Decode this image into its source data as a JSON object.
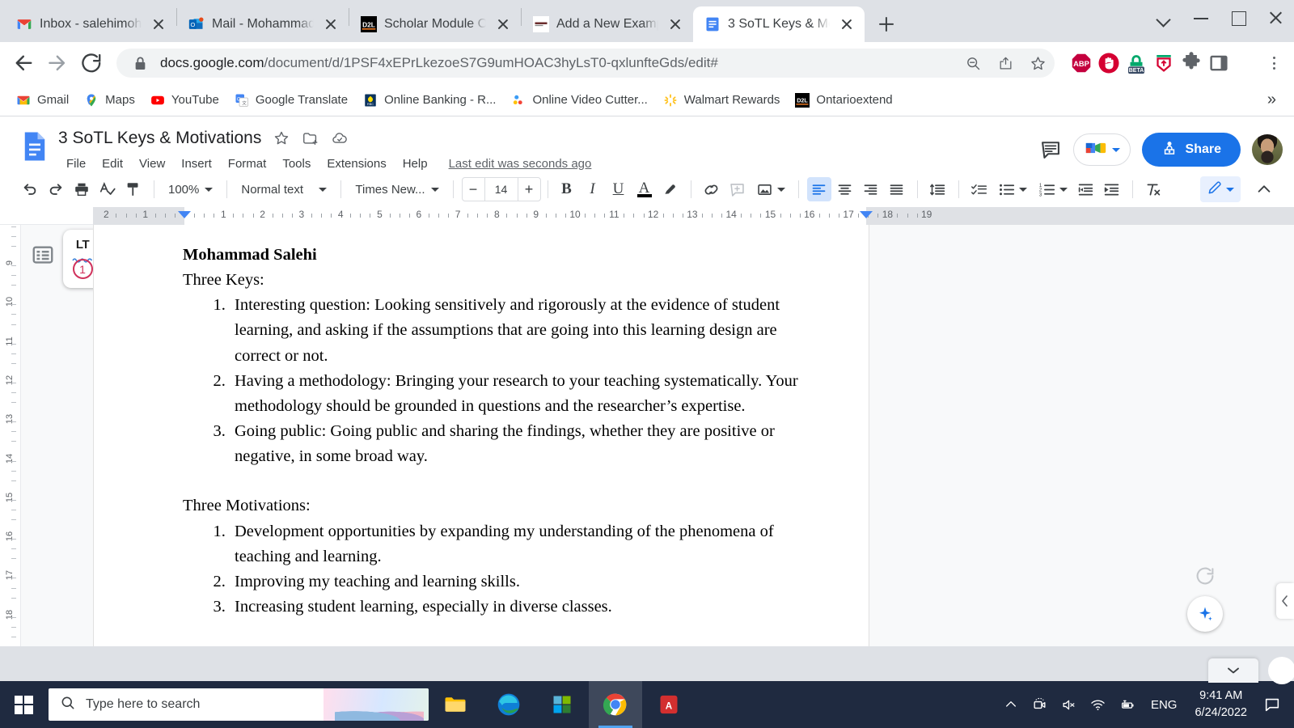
{
  "browser": {
    "tabs": [
      {
        "title": "Inbox - salehimoh",
        "favicon": "gmail-icon",
        "active": false
      },
      {
        "title": "Mail - Mohammad",
        "favicon": "outlook-icon",
        "active": false
      },
      {
        "title": "Scholar Module O",
        "favicon": "d2l-icon",
        "active": false
      },
      {
        "title": "Add a New Examp",
        "favicon": "generic-site-icon",
        "active": false
      },
      {
        "title": "3 SoTL Keys & Mo",
        "favicon": "google-docs-icon",
        "active": true
      }
    ],
    "new_tab_label": "+",
    "window_controls": [
      "chevron-down",
      "minimize",
      "maximize",
      "close"
    ],
    "nav": {
      "back": "back-arrow",
      "forward": "forward-arrow",
      "reload": "reload-icon",
      "lock": "lock-icon"
    },
    "url_host": "docs.google.com",
    "url_path": "/document/d/1PSF4xEPrLkezoeS7G9umHOAC3hyLsT0-qxlunfteGds/edit#",
    "omnibox_icons": [
      "zoom-out-icon",
      "share-icon",
      "bookmark-star-icon"
    ],
    "extensions": [
      "adblock-plus-icon",
      "adblocker-hand-icon",
      "beta-lock-icon",
      "shield-icon",
      "puzzle-icon",
      "side-panel-icon"
    ],
    "profile": "profile-avatar",
    "menu": "chrome-menu-icon",
    "bookmarks": [
      {
        "label": "Gmail",
        "icon": "gmail-icon"
      },
      {
        "label": "Maps",
        "icon": "google-maps-icon"
      },
      {
        "label": "YouTube",
        "icon": "youtube-icon"
      },
      {
        "label": "Google Translate",
        "icon": "google-translate-icon"
      },
      {
        "label": "Online Banking - R...",
        "icon": "rbc-icon"
      },
      {
        "label": "Online Video Cutter...",
        "icon": "video-cutter-icon"
      },
      {
        "label": "Walmart Rewards",
        "icon": "walmart-icon"
      },
      {
        "label": "Ontarioextend",
        "icon": "d2l-icon"
      }
    ],
    "bookmarks_overflow": "»"
  },
  "docs": {
    "title": "3 SoTL Keys & Motivations",
    "title_icons": [
      "star-icon",
      "move-to-folder-icon",
      "cloud-saved-icon"
    ],
    "menu": [
      "File",
      "Edit",
      "View",
      "Insert",
      "Format",
      "Tools",
      "Extensions",
      "Help"
    ],
    "last_edit": "Last edit was seconds ago",
    "comment_icon": "comment-history-icon",
    "meet_icon": "google-meet-icon",
    "share_label": "Share",
    "share_color": "#1a73e8",
    "user_avatar": "user-avatar",
    "toolbar": {
      "undo": "undo-icon",
      "redo": "redo-icon",
      "print": "print-icon",
      "spellcheck": "spellcheck-icon",
      "paint_format": "paint-format-icon",
      "zoom": "100%",
      "style": "Normal text",
      "font": "Times New...",
      "font_size": "14",
      "decrease": "−",
      "increase": "+",
      "bold": "B",
      "italic": "I",
      "underline": "U",
      "text_color": "A",
      "highlight": "highlight-icon",
      "link": "link-icon",
      "comment": "add-comment-icon",
      "image": "insert-image-icon",
      "align_left": "align-left-icon",
      "align_center": "align-center-icon",
      "align_right": "align-right-icon",
      "align_justify": "align-justify-icon",
      "line_spacing": "line-spacing-icon",
      "checklist": "checklist-icon",
      "bulleted_list": "bulleted-list-icon",
      "numbered_list": "numbered-list-icon",
      "decrease_indent": "decrease-indent-icon",
      "increase_indent": "increase-indent-icon",
      "clear_formatting": "clear-formatting-icon",
      "editing_mode": "pencil-icon",
      "collapse": "collapse-toolbar-icon"
    },
    "ruler": {
      "left_numbers": [
        "2",
        "1"
      ],
      "numbers": [
        "1",
        "2",
        "3",
        "4",
        "5",
        "6",
        "7",
        "8",
        "9",
        "10",
        "11",
        "12",
        "13",
        "14",
        "15",
        "16",
        "17",
        "18",
        "19"
      ],
      "left_indent_marker": "indent-marker",
      "right_indent_marker": "right-indent-marker"
    },
    "sidebar": {
      "outline_icon": "document-outline-icon",
      "languagetool": {
        "logo": "LT",
        "count": "1"
      }
    },
    "document": {
      "author": "Mohammad Salehi",
      "section1_heading": "Three Keys:",
      "section1_items": [
        "Interesting question: Looking sensitively and rigorously at the evidence of student learning, and asking if the assumptions that are going into this learning design are correct or not.",
        "Having a methodology: Bringing your research to your teaching systematically. Your methodology should be grounded in questions and the researcher’s expertise.",
        "Going public: Going public and sharing the findings, whether they are positive or negative, in some broad way."
      ],
      "section2_heading": "Three Motivations:",
      "section2_items": [
        "Development opportunities by expanding my understanding of the phenomena of teaching and learning.",
        "Improving my teaching and learning skills.",
        "Increasing student learning, especially in diverse classes."
      ]
    },
    "floating": {
      "refresh": "refresh-icon",
      "explore": "explore-icon",
      "side_panel_toggle": "side-panel-toggle-icon"
    }
  },
  "taskbar": {
    "start": "windows-start-icon",
    "search_placeholder": "Type here to search",
    "apps": [
      "file-explorer-icon",
      "microsoft-edge-icon",
      "microsoft-store-icon",
      "google-chrome-icon",
      "adobe-acrobat-icon"
    ],
    "tray": [
      "show-hidden-icons",
      "camera-icon",
      "volume-muted-icon",
      "wifi-icon",
      "battery-charging-icon"
    ],
    "language": "ENG",
    "time": "9:41 AM",
    "date": "6/24/2022",
    "notifications": "notifications-icon"
  }
}
